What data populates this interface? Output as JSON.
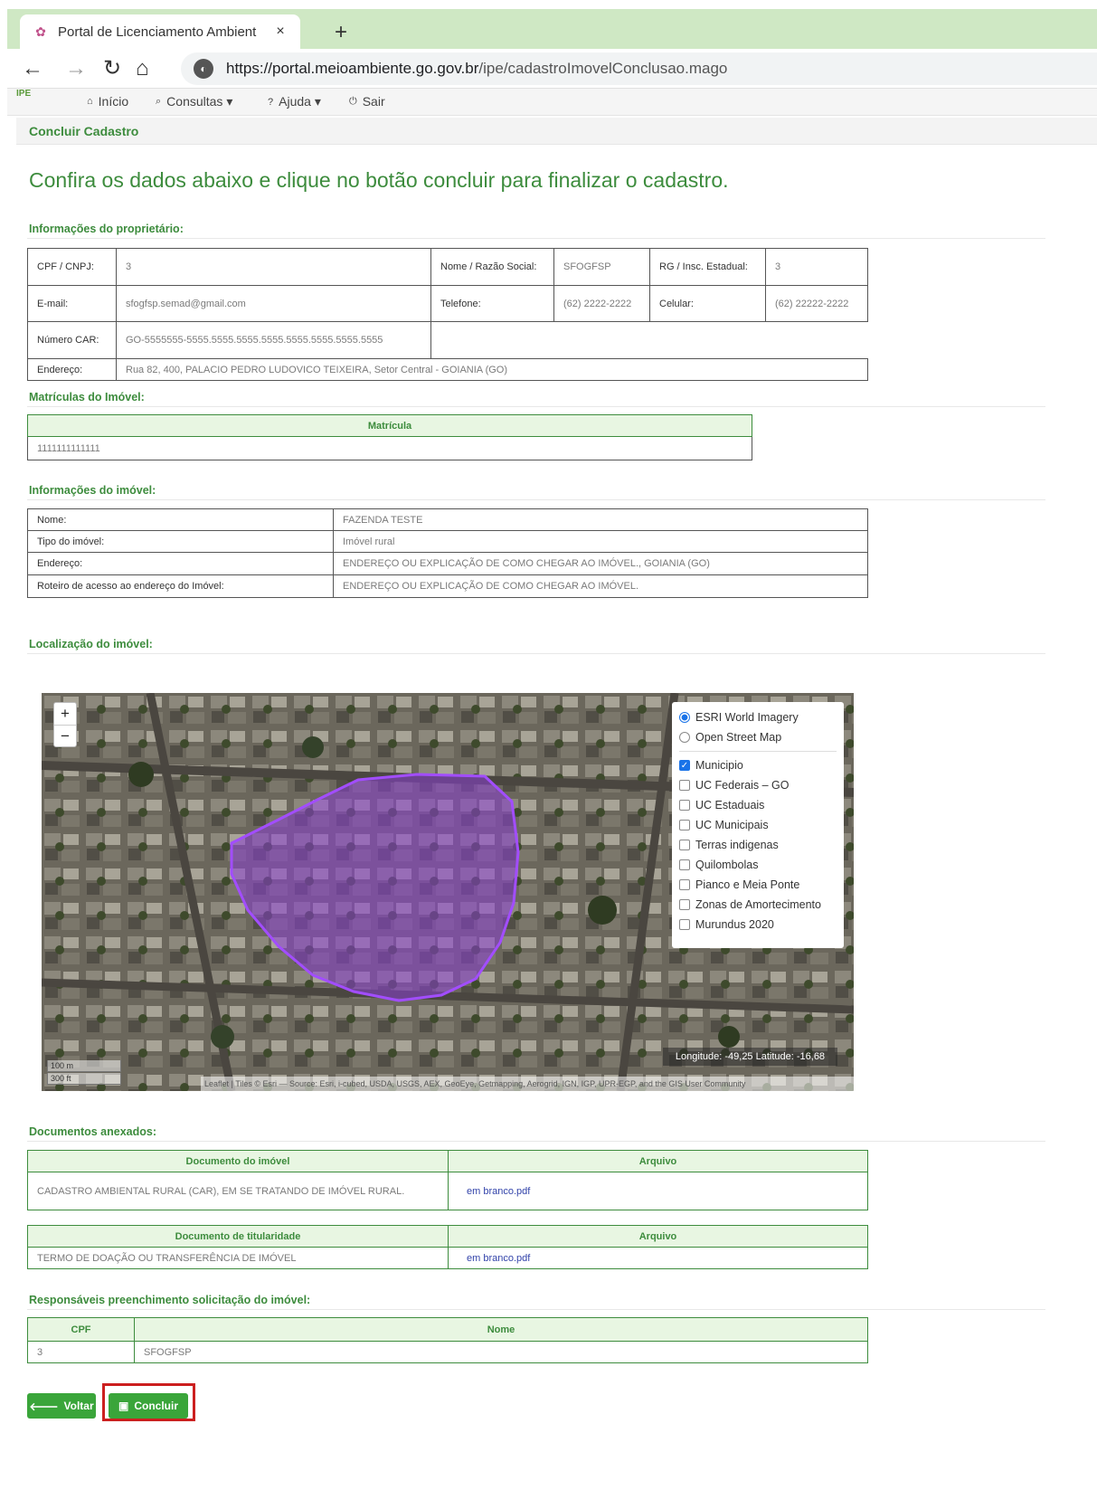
{
  "browser": {
    "tab_title": "Portal de Licenciamento Ambient",
    "tab_close": "×",
    "new_tab": "+",
    "url_scheme_host": "https://portal.meioambiente.go.gov.br",
    "url_path": "/ipe/cadastroImovelConclusao.mago"
  },
  "nav": {
    "logo": "IPE",
    "items": [
      {
        "label": "Início",
        "icon": "home-icon"
      },
      {
        "label": "Consultas ▾",
        "icon": "search-icon"
      },
      {
        "label": "Ajuda ▾",
        "icon": "question-icon"
      },
      {
        "label": "Sair",
        "icon": "power-icon"
      }
    ]
  },
  "breadcrumb": "Concluir Cadastro",
  "headline": "Confira os dados abaixo e clique no botão concluir para finalizar o cadastro.",
  "owner": {
    "title": "Informações do proprietário:",
    "cpf_label": "CPF / CNPJ:",
    "cpf_value": "3",
    "nome_label": "Nome / Razão Social:",
    "nome_value": "SFOGFSP",
    "rg_label": "RG / Insc. Estadual:",
    "rg_value": "3",
    "email_label": "E-mail:",
    "email_value": "sfogfsp.semad@gmail.com",
    "telefone_label": "Telefone:",
    "telefone_value": "(62) 2222-2222",
    "celular_label": "Celular:",
    "celular_value": "(62) 22222-2222",
    "car_label": "Número CAR:",
    "car_value": "GO-5555555-5555.5555.5555.5555.5555.5555.5555.5555",
    "endereco_label": "Endereço:",
    "endereco_value": "Rua 82, 400, PALACIO PEDRO LUDOVICO TEIXEIRA, Setor Central - GOIANIA (GO)"
  },
  "matriculas": {
    "title": "Matrículas do Imóvel:",
    "header": "Matrícula",
    "rows": [
      "1111111111111"
    ]
  },
  "imovel": {
    "title": "Informações do imóvel:",
    "rows": [
      {
        "label": "Nome:",
        "value": "FAZENDA TESTE"
      },
      {
        "label": "Tipo do imóvel:",
        "value": "Imóvel rural"
      },
      {
        "label": "Endereço:",
        "value": "ENDEREÇO OU EXPLICAÇÃO DE COMO CHEGAR AO IMÓVEL., GOIANIA (GO)"
      },
      {
        "label": "Roteiro de acesso ao endereço do Imóvel:",
        "value": "ENDEREÇO OU EXPLICAÇÃO DE COMO CHEGAR AO IMÓVEL."
      }
    ]
  },
  "map": {
    "title": "Localização do imóvel:",
    "zoom_in": "+",
    "zoom_out": "−",
    "base_layers": [
      {
        "label": "ESRI World Imagery",
        "selected": true
      },
      {
        "label": "Open Street Map",
        "selected": false
      }
    ],
    "overlays": [
      {
        "label": "Municipio",
        "checked": true
      },
      {
        "label": "UC Federais – GO",
        "checked": false
      },
      {
        "label": "UC Estaduais",
        "checked": false
      },
      {
        "label": "UC Municipais",
        "checked": false
      },
      {
        "label": "Terras indigenas",
        "checked": false
      },
      {
        "label": "Quilombolas",
        "checked": false
      },
      {
        "label": "Pianco e Meia Ponte",
        "checked": false
      },
      {
        "label": "Zonas de Amortecimento",
        "checked": false
      },
      {
        "label": "Murundus 2020",
        "checked": false
      }
    ],
    "coords": "Longitude: -49,25 Latitude: -16,68",
    "scale_m": "100 m",
    "scale_ft": "300 ft",
    "attribution": "Leaflet | Tiles © Esri — Source: Esri, i-cubed, USDA, USGS, AEX, GeoEye, Getmapping, Aerogrid, IGN, IGP, UPR-EGP, and the GIS User Community",
    "polygon_color": "#8a3fd1"
  },
  "documentos": {
    "title": "Documentos anexados:",
    "imovel_header": "Documento do imóvel",
    "arquivo_header": "Arquivo",
    "imovel_doc": "CADASTRO AMBIENTAL RURAL (CAR), EM SE TRATANDO DE IMÓVEL RURAL.",
    "imovel_file": "em branco.pdf",
    "titularidade_header": "Documento de titularidade",
    "titularidade_doc": "TERMO DE DOAÇÃO OU TRANSFERÊNCIA DE IMÓVEL",
    "titularidade_file": "em branco.pdf"
  },
  "responsaveis": {
    "title": "Responsáveis preenchimento solicitação do imóvel:",
    "cpf_header": "CPF",
    "nome_header": "Nome",
    "cpf": "3",
    "nome": "SFOGFSP"
  },
  "buttons": {
    "voltar": "Voltar",
    "concluir": "Concluir"
  },
  "colors": {
    "accent_green": "#3d8c3d",
    "button_green": "#3aa53a",
    "highlight_red": "#cc1f1f"
  }
}
